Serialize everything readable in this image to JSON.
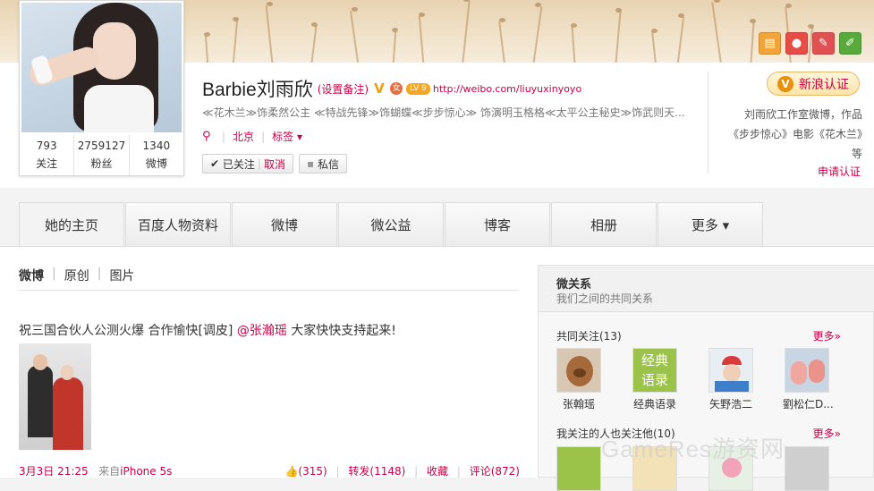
{
  "profile": {
    "name": "Barbie刘雨欣",
    "remark": "(设置备注)",
    "verified_badge": "V",
    "gender_badge": "女",
    "level": "LV 9",
    "homepage": "http://weibo.com/liuyuxinyoyo",
    "description": "≪花木兰≫饰柔然公主 ≪特战先锋≫饰蝴蝶≪步步惊心≫ 饰演明玉格格≪太平公主秘史≫饰武则天...",
    "city": "北京",
    "tags": "标签",
    "stats": [
      {
        "num": "793",
        "label": "关注"
      },
      {
        "num": "2759127",
        "label": "粉丝"
      },
      {
        "num": "1340",
        "label": "微博"
      }
    ],
    "follow_label": "已关注",
    "cancel_label": "取消",
    "message_label": "私信"
  },
  "verification": {
    "button": "新浪认证",
    "description": "刘雨欣工作室微博，作品《步步惊心》电影《花木兰》等",
    "apply_link": "申请认证"
  },
  "nav": [
    "她的主页",
    "百度人物资料",
    "微博",
    "微公益",
    "博客",
    "相册",
    "更多 ▾"
  ],
  "feed_tabs": [
    "微博",
    "原创",
    "图片"
  ],
  "post": {
    "text_before": "祝三国合伙人公测火爆 合作愉快[调皮] ",
    "mention": "@张瀚瑶",
    "text_after": " 大家快快支持起来!",
    "time": "3月3日 21:25",
    "source_prefix": "来自",
    "source": "iPhone 5s",
    "likes": "(315)",
    "reposts": "转发(1148)",
    "favorite": "收藏",
    "comments": "评论(872)"
  },
  "panel": {
    "title": "微关系",
    "subtitle": "我们之间的共同关系",
    "common_follow": "共同关注(13)",
    "more1": "更多»",
    "friends": [
      "张翰瑶",
      "经典语录",
      "矢野浩二",
      "劉松仁D..."
    ],
    "also_follow": "我关注的人也关注他(10)",
    "more2": "更多»"
  },
  "watermark": "GameRes游资网",
  "colors": {
    "accent": "#cc0044",
    "verify": "#e8900b"
  }
}
